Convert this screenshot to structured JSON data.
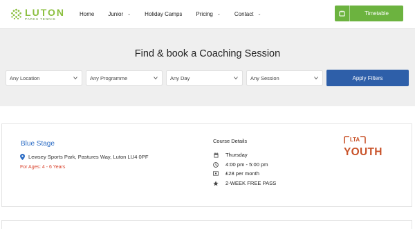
{
  "header": {
    "logo": {
      "name": "LUTON",
      "sub": "PARKS TENNIS"
    },
    "nav": [
      {
        "label": "Home",
        "dropdown": false
      },
      {
        "label": "Junior",
        "dropdown": true
      },
      {
        "label": "Holiday Camps",
        "dropdown": false
      },
      {
        "label": "Pricing",
        "dropdown": true
      },
      {
        "label": "Contact",
        "dropdown": true
      }
    ],
    "timetable_label": "Timetable"
  },
  "search": {
    "title": "Find & book a Coaching Session",
    "filters": [
      {
        "selected": "Any Location"
      },
      {
        "selected": "Any Programme"
      },
      {
        "selected": "Any Day"
      },
      {
        "selected": "Any Session"
      }
    ],
    "apply_label": "Apply Filters"
  },
  "result": {
    "venue": "Blue Stage",
    "address": "Lewsey Sports Park, Pastures Way, Luton LU4 0PF",
    "ages": "For Ages: 4 - 6 Years",
    "course_heading": "Course Details",
    "details": [
      {
        "icon": "calendar-icon",
        "text": "Thursday"
      },
      {
        "icon": "clock-icon",
        "text": "4:00 pm - 5:00 pm"
      },
      {
        "icon": "money-icon",
        "text": "£28 per month"
      },
      {
        "icon": "star-icon",
        "text": "2-WEEK FREE PASS"
      }
    ],
    "badge": {
      "top": "LTA",
      "bottom": "YOUTH"
    }
  },
  "colors": {
    "brand_green": "#6cb33f",
    "apply_blue": "#2e5fa9",
    "link_blue": "#2a6bc4",
    "ages_red": "#d9442e",
    "lta_orange": "#c9532a",
    "panel_gray": "#efefef"
  }
}
